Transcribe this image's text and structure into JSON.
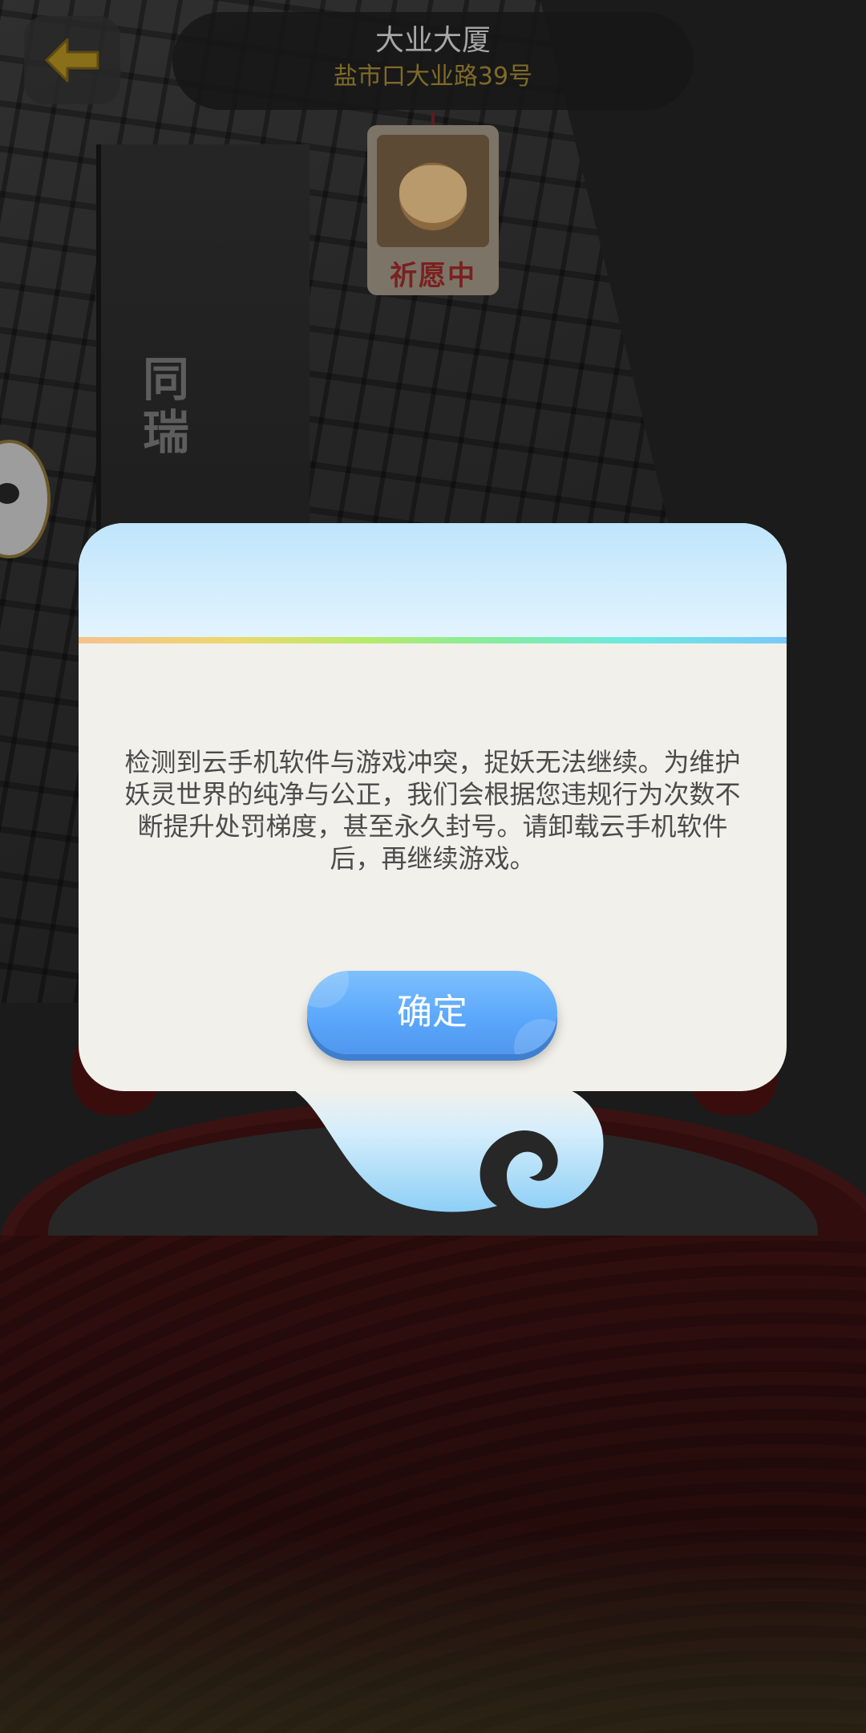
{
  "header": {
    "location_name": "大业大厦",
    "location_address": "盐市口大业路39号"
  },
  "dog_card": {
    "label": "祈愿中"
  },
  "background": {
    "building_sign": "同瑞"
  },
  "dialog": {
    "message": "检测到云手机软件与游戏冲突，捉妖无法继续。为维护妖灵世界的纯净与公正，我们会根据您违规行为次数不断提升处罚梯度，甚至永久封号。请卸载云手机软件后，再继续游戏。",
    "confirm_label": "确定"
  },
  "icons": {
    "back": "arrow-left-icon"
  },
  "colors": {
    "back_arrow": "#8a6f1a",
    "address_text": "#7f6a28",
    "button_blue": "#5aa6fb",
    "dialog_bg": "#f2f0ea"
  }
}
